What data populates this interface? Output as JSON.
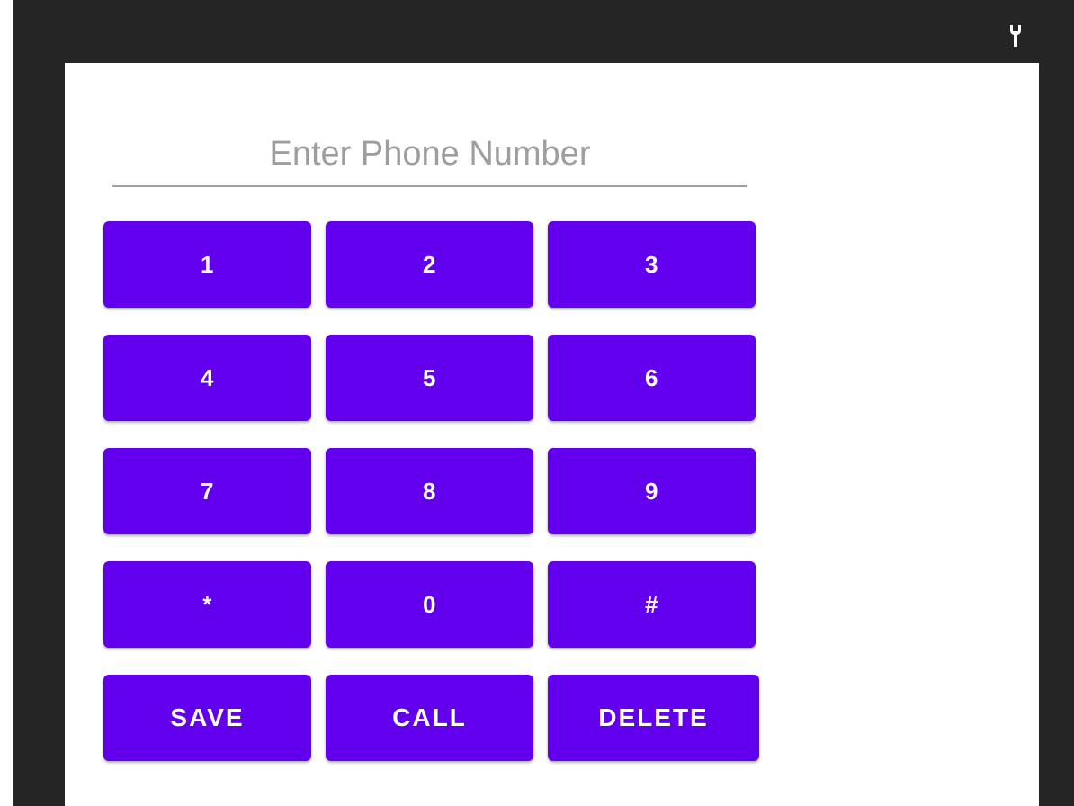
{
  "dialer": {
    "input": {
      "value": "",
      "placeholder": "Enter Phone Number"
    },
    "keys": [
      {
        "label": "1"
      },
      {
        "label": "2"
      },
      {
        "label": "3"
      },
      {
        "label": "4"
      },
      {
        "label": "5"
      },
      {
        "label": "6"
      },
      {
        "label": "7"
      },
      {
        "label": "8"
      },
      {
        "label": "9"
      },
      {
        "label": "*"
      },
      {
        "label": "0"
      },
      {
        "label": "#"
      }
    ],
    "actions": {
      "save": "SAVE",
      "call": "CALL",
      "delete": "DELETE"
    }
  },
  "icons": {
    "status": "wrench-icon"
  },
  "colors": {
    "accent": "#6200ee",
    "frame": "#252525",
    "hint": "#9e9e9e"
  }
}
